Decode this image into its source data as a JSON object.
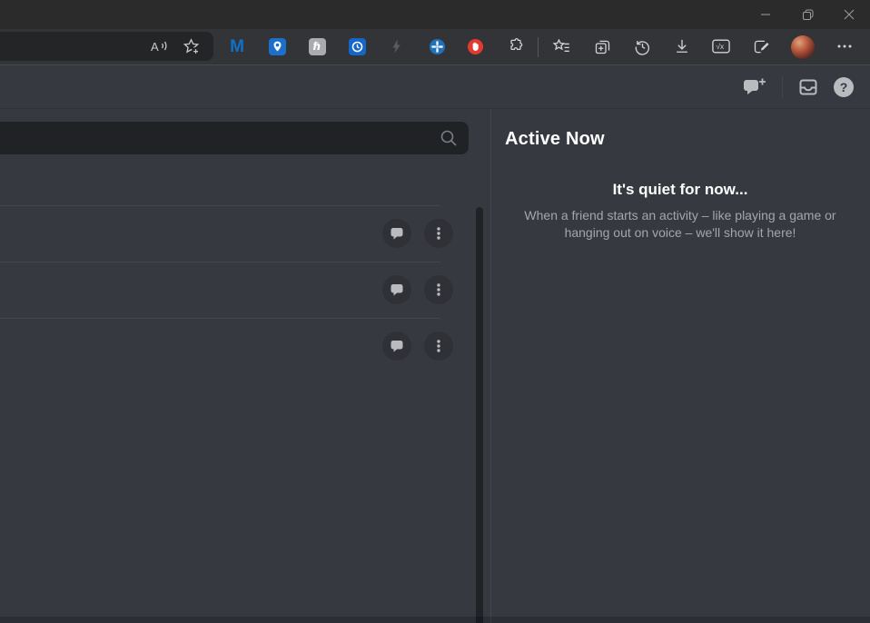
{
  "browser": {
    "window_controls": [
      {
        "name": "minimize"
      },
      {
        "name": "restore"
      },
      {
        "name": "close"
      }
    ],
    "toolbar": {
      "read_aloud_glyph": "A",
      "malwarebytes_glyph": "M",
      "hbar_glyph": "ℏ",
      "math_glyph": "√x",
      "icons": [
        "read-aloud",
        "add-favorite",
        "malwarebytes-extension",
        "map-pin-extension",
        "hbar-extension",
        "backup-clock-extension",
        "lightning-extension",
        "pinwheel-extension",
        "hand-blocker-extension",
        "extensions-puzzle",
        "favorites",
        "collections",
        "history",
        "downloads",
        "math-solver",
        "web-capture",
        "profile-avatar",
        "more-menu"
      ]
    }
  },
  "discord": {
    "header": {
      "icons": [
        "new-group-dm",
        "inbox",
        "help"
      ],
      "help_glyph": "?"
    },
    "search": {
      "value": "",
      "placeholder": ""
    },
    "friends": {
      "rows": [
        {
          "actions": [
            "message",
            "more"
          ]
        },
        {
          "actions": [
            "message",
            "more"
          ]
        },
        {
          "actions": [
            "message",
            "more"
          ]
        }
      ]
    },
    "active_now": {
      "title": "Active Now",
      "empty_title": "It's quiet for now...",
      "empty_body": "When a friend starts an activity – like playing a game or hanging out on voice – we'll show it here!"
    }
  },
  "colors": {
    "discord_bg": "#36393f",
    "search_bg": "#202225",
    "icon_gray": "#b9bbbe",
    "text_muted": "#a3a6aa",
    "titlebar_bg": "#2b2b2b",
    "toolbar_bg": "#333437",
    "extension_blue": "#1c70c9",
    "blocker_red": "#e13b30"
  }
}
